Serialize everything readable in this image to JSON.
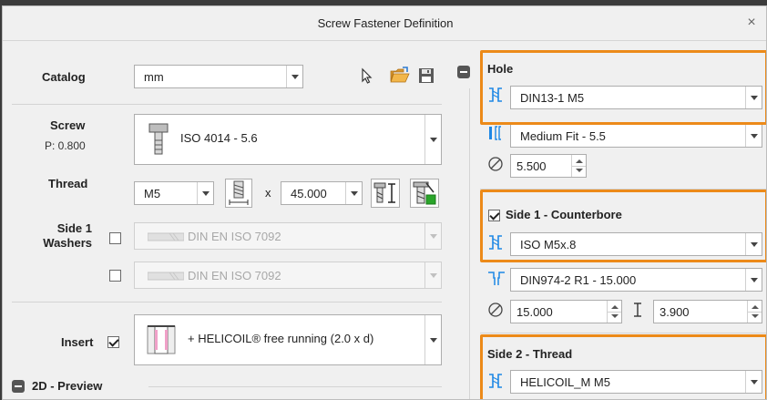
{
  "window": {
    "title": "Screw Fastener Definition",
    "close_glyph": "×"
  },
  "left": {
    "catalog": {
      "label": "Catalog",
      "value": "mm"
    },
    "screw": {
      "label": "Screw",
      "pitch": "P: 0.800",
      "value": "ISO 4014 - 5.6"
    },
    "thread": {
      "label": "Thread",
      "size": "M5",
      "x": "x",
      "length": "45.000"
    },
    "washers": {
      "label_line1": "Side 1",
      "label_line2": "Washers",
      "row1": "DIN EN ISO 7092",
      "row2": "DIN EN ISO 7092"
    },
    "insert": {
      "label": "Insert",
      "value": "+ HELICOIL® free running (2.0 x d)"
    },
    "preview": {
      "label": "2D - Preview"
    }
  },
  "right": {
    "hole": {
      "title": "Hole",
      "value": "DIN13-1 M5",
      "fit": "Medium Fit - 5.5",
      "diameter": "5.500"
    },
    "side1": {
      "title": "Side 1 - Counterbore",
      "value": "ISO M5x.8",
      "standard": "DIN974-2 R1 - 15.000",
      "diameter": "15.000",
      "depth": "3.900"
    },
    "side2": {
      "title": "Side 2 - Thread",
      "value": "HELICOIL_M M5"
    }
  },
  "colors": {
    "highlight": "#ec8a19",
    "accent_blue": "#1e88e5",
    "green": "#2aa52a",
    "folder": "#e8a33a"
  }
}
